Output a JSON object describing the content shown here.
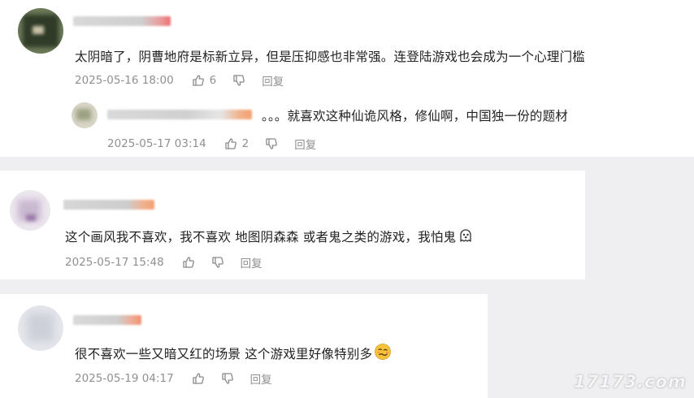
{
  "comments": [
    {
      "text": "太阴暗了，阴曹地府是标新立异，但是压抑感也非常强。连登陆游戏也会成为一个心理门槛",
      "date": "2025-05-16 18:00",
      "likes": "6",
      "reply_label": "回复",
      "reply": {
        "text": "。。。就喜欢这种仙诡风格，修仙啊，中国独一份的题材",
        "date": "2025-05-17 03:14",
        "likes": "2",
        "reply_label": "回复"
      }
    },
    {
      "text": "这个画风我不喜欢，我不喜欢 地图阴森森 或者鬼之类的游戏，我怕鬼",
      "emoji": "ghost-emoji",
      "date": "2025-05-17 15:48",
      "reply_label": "回复"
    },
    {
      "text": "很不喜欢一些又暗又红的场景 这个游戏里好像特别多",
      "emoji": "woozy-face-emoji",
      "date": "2025-05-19 04:17",
      "reply_label": "回复"
    }
  ],
  "watermark": "17173.com",
  "colors": {
    "page_background": "#efeff1",
    "card_background": "#ffffff",
    "text": "#222222",
    "meta_text": "#909090"
  }
}
